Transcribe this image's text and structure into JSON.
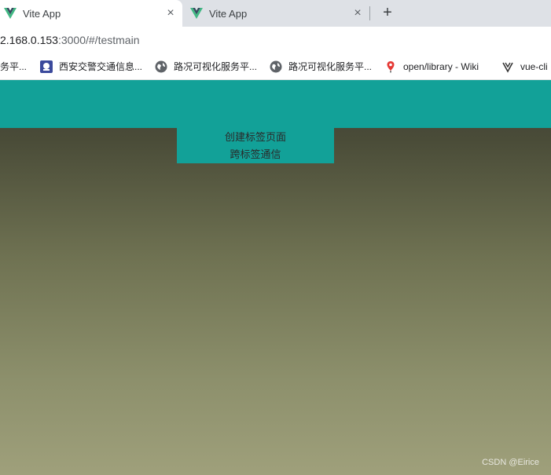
{
  "browser": {
    "tabs": [
      {
        "title": "Vite App",
        "close": "×"
      },
      {
        "title": "Vite App",
        "close": "×"
      }
    ],
    "new_tab": "+",
    "address": {
      "host": "2.168.0.153",
      "path": ":3000/#/testmain"
    },
    "bookmarks": [
      {
        "label": "务平...",
        "icon": "truncated-icon"
      },
      {
        "label": "西安交警交通信息...",
        "icon": "police-badge-icon"
      },
      {
        "label": "路况可视化服务平...",
        "icon": "globe-icon"
      },
      {
        "label": "路况可视化服务平...",
        "icon": "globe-icon"
      },
      {
        "label": "open/library - Wiki",
        "icon": "map-pin-icon"
      },
      {
        "label": "vue-cli",
        "icon": "vue-cli-icon"
      }
    ]
  },
  "page": {
    "menu": {
      "create_tab": "创建标签页面",
      "cross_tab": "跨标签通信"
    },
    "watermark": "CSDN @Eirice"
  },
  "colors": {
    "teal": "#12a198",
    "vue_green": "#41b883",
    "vue_dark": "#35495e"
  }
}
